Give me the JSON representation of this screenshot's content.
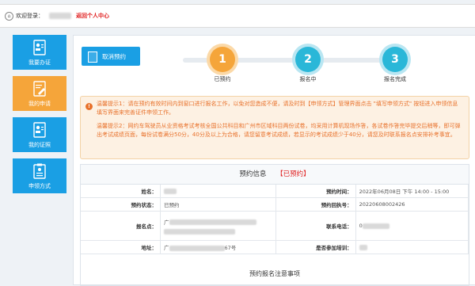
{
  "topbar": {
    "welcome": "欢迎登录：",
    "back_link": "返回个人中心"
  },
  "sidebar": {
    "items": [
      {
        "label": "我要办证",
        "icon": "id-card-icon",
        "active": false
      },
      {
        "label": "我的申请",
        "icon": "edit-document-icon",
        "active": true
      },
      {
        "label": "我的证照",
        "icon": "id-card-icon",
        "active": false
      },
      {
        "label": "申领方式",
        "icon": "clipboard-icon",
        "active": false
      }
    ]
  },
  "toolbar": {
    "cancel_label": "取消预约"
  },
  "steps": [
    {
      "num": "1",
      "label": "已预约"
    },
    {
      "num": "2",
      "label": "报名中"
    },
    {
      "num": "3",
      "label": "报名完成"
    }
  ],
  "notices": [
    "温馨提示1：请在预约有效时间内到窗口进行报名工作，以免对您造成不便，请及时到【申领方式】管理界面点击 \"填写申领方式\" 按钮进入申领信息填写界面来完善证件申领工作。",
    "温馨提示2：网约车驾驶员从业资格考试考核全国公共科目和广州市区域科目两份试卷，均采用计算机现场作答，各试卷作答完毕提交后稍等，即可弹出考试成绩页面，每份试卷满分50分，40分及以上为合格，请您留意考试成绩，若显示的考试成绩少于40分，请您及时联系报名点安排补考事宜。"
  ],
  "panel": {
    "title": "预约信息",
    "status": "【已预约】",
    "rows": [
      {
        "k1": "姓名：",
        "v1": "",
        "k2": "预约时间：",
        "v2": "2022年06月08日 下午 14:00 - 15:00"
      },
      {
        "k1": "预约状态：",
        "v1": "已预约",
        "k2": "预约回执号：",
        "v2": "20220608002426"
      },
      {
        "k1": "报名点：",
        "v1": "广",
        "k2": "联系电话：",
        "v2": "0"
      },
      {
        "k1": "地址：",
        "v1": "广",
        "v1b": "67号",
        "k2": "是否参加培训：",
        "v2": ""
      }
    ],
    "notice_title": "预约报名注意事项"
  },
  "colors": {
    "primary": "#1a9fe4",
    "accent": "#f5a53a",
    "warning_text": "#e8712b",
    "status_red": "#e02020"
  }
}
